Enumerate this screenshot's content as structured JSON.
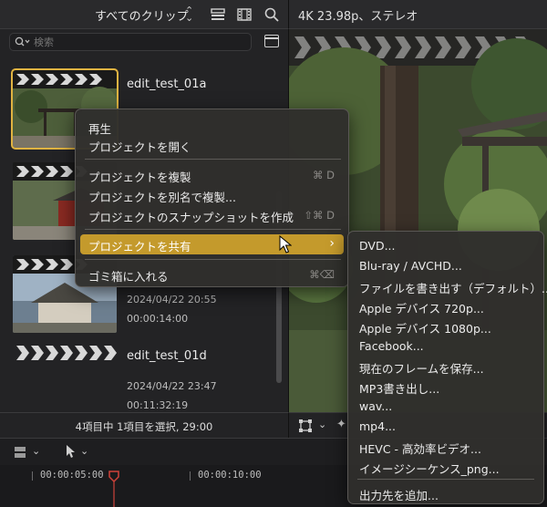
{
  "browser": {
    "library_title": "すべてのクリップ",
    "search_placeholder": "検索",
    "status": "4項目中 1項目を選択, 29:00"
  },
  "clips": [
    {
      "name": "edit_test_01a",
      "date": "",
      "duration": "",
      "selected": true
    },
    {
      "name": "",
      "date": "",
      "duration": "",
      "selected": false
    },
    {
      "name": "",
      "date": "2024/04/22 20:55",
      "duration": "00:00:14:00",
      "selected": false
    },
    {
      "name": "edit_test_01d",
      "date": "2024/04/22 23:47",
      "duration": "00:11:32:19",
      "selected": false
    }
  ],
  "viewer": {
    "format_info": "4K 23.98p、ステレオ"
  },
  "timeline": {
    "timecodes": [
      "00:00:05:00",
      "00:00:10:00"
    ]
  },
  "context_menu": {
    "items": [
      {
        "label": "再生",
        "shortcut": ""
      },
      {
        "label": "プロジェクトを開く",
        "shortcut": ""
      },
      {
        "label": "プロジェクトを複製",
        "shortcut": "⌘ D"
      },
      {
        "label": "プロジェクトを別名で複製...",
        "shortcut": ""
      },
      {
        "label": "プロジェクトのスナップショットを作成",
        "shortcut": "⇧⌘ D"
      },
      {
        "label": "プロジェクトを共有",
        "shortcut": "",
        "submenu": true,
        "active": true
      },
      {
        "label": "ゴミ箱に入れる",
        "shortcut": "⌘⌫"
      }
    ]
  },
  "share_submenu": {
    "items": [
      "DVD...",
      "Blu-ray / AVCHD...",
      "ファイルを書き出す（デフォルト）...",
      "Apple デバイス 720p...",
      "Apple デバイス 1080p...",
      "Facebook...",
      "現在のフレームを保存...",
      "MP3書き出し...",
      "wav...",
      "mp4...",
      "HEVC - 高効率ビデオ...",
      "イメージシーケンス_png..."
    ],
    "add_destination": "出力先を追加..."
  },
  "colors": {
    "accent": "#c49a2c",
    "selection_outline": "#e0b341",
    "panel": "#232325"
  }
}
